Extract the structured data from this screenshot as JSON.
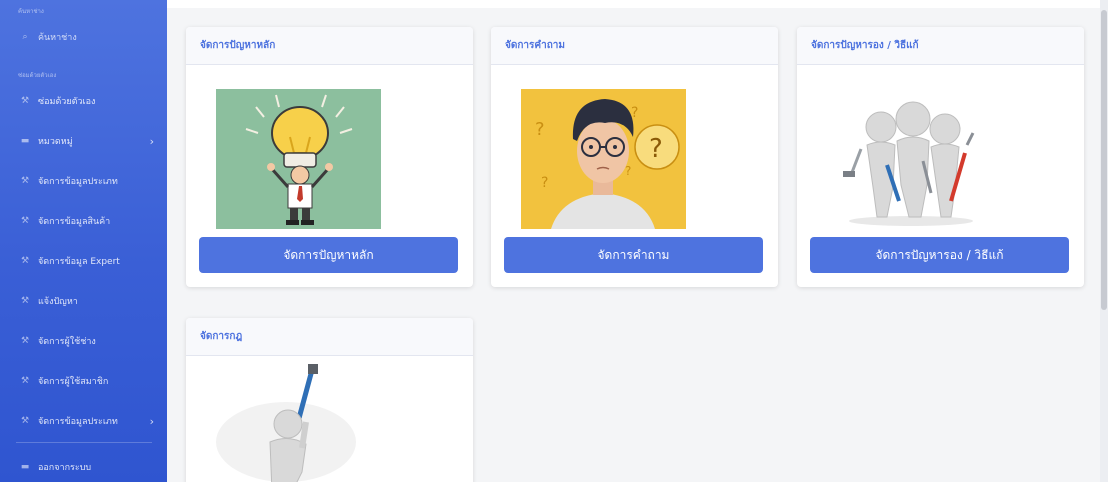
{
  "sidebar": {
    "top_heading": "ค้นหาช่าง",
    "search_label": "ค้นหาช่าง",
    "section_heading": "ซ่อมด้วยตัวเอง",
    "items": [
      {
        "label": "ซ่อมด้วยตัวเอง",
        "icon": "wrench-icon"
      },
      {
        "label": "หมวดหมู่",
        "icon": "folder-icon",
        "has_chevron": true
      },
      {
        "label": "จัดการข้อมูลประเภท",
        "icon": "wrench-icon"
      },
      {
        "label": "จัดการข้อมูลสินค้า",
        "icon": "wrench-icon"
      },
      {
        "label": "จัดการข้อมูล Expert",
        "icon": "wrench-icon"
      },
      {
        "label": "แจ้งปัญหา",
        "icon": "wrench-icon"
      },
      {
        "label": "จัดการผู้ใช้ช่าง",
        "icon": "wrench-icon"
      },
      {
        "label": "จัดการผู้ใช้สมาชิก",
        "icon": "wrench-icon"
      },
      {
        "label": "จัดการข้อมูลประเภท",
        "icon": "wrench-icon",
        "has_chevron": true
      }
    ],
    "logout_label": "ออกจากระบบ",
    "chevron": "›"
  },
  "cards": [
    {
      "title": "จัดการปัญหาหลัก",
      "button": "จัดการปัญหาหลัก",
      "image": "lightbulb-person-illustration"
    },
    {
      "title": "จัดการคำถาม",
      "button": "จัดการคำถาม",
      "image": "confused-person-illustration"
    },
    {
      "title": "จัดการปัญหารอง / วิธีแก้",
      "button": "จัดการปัญหารอง / วิธีแก้",
      "image": "3d-workers-with-tools-illustration"
    },
    {
      "title": "จัดการกฎ",
      "image": "3d-figure-with-tool-illustration"
    }
  ],
  "colors": {
    "accent": "#4e73df",
    "sidebar_top": "#4e73df",
    "sidebar_bottom": "#2f55d0",
    "card_header_text": "#4e73df",
    "page_bg": "#f4f5f7"
  }
}
